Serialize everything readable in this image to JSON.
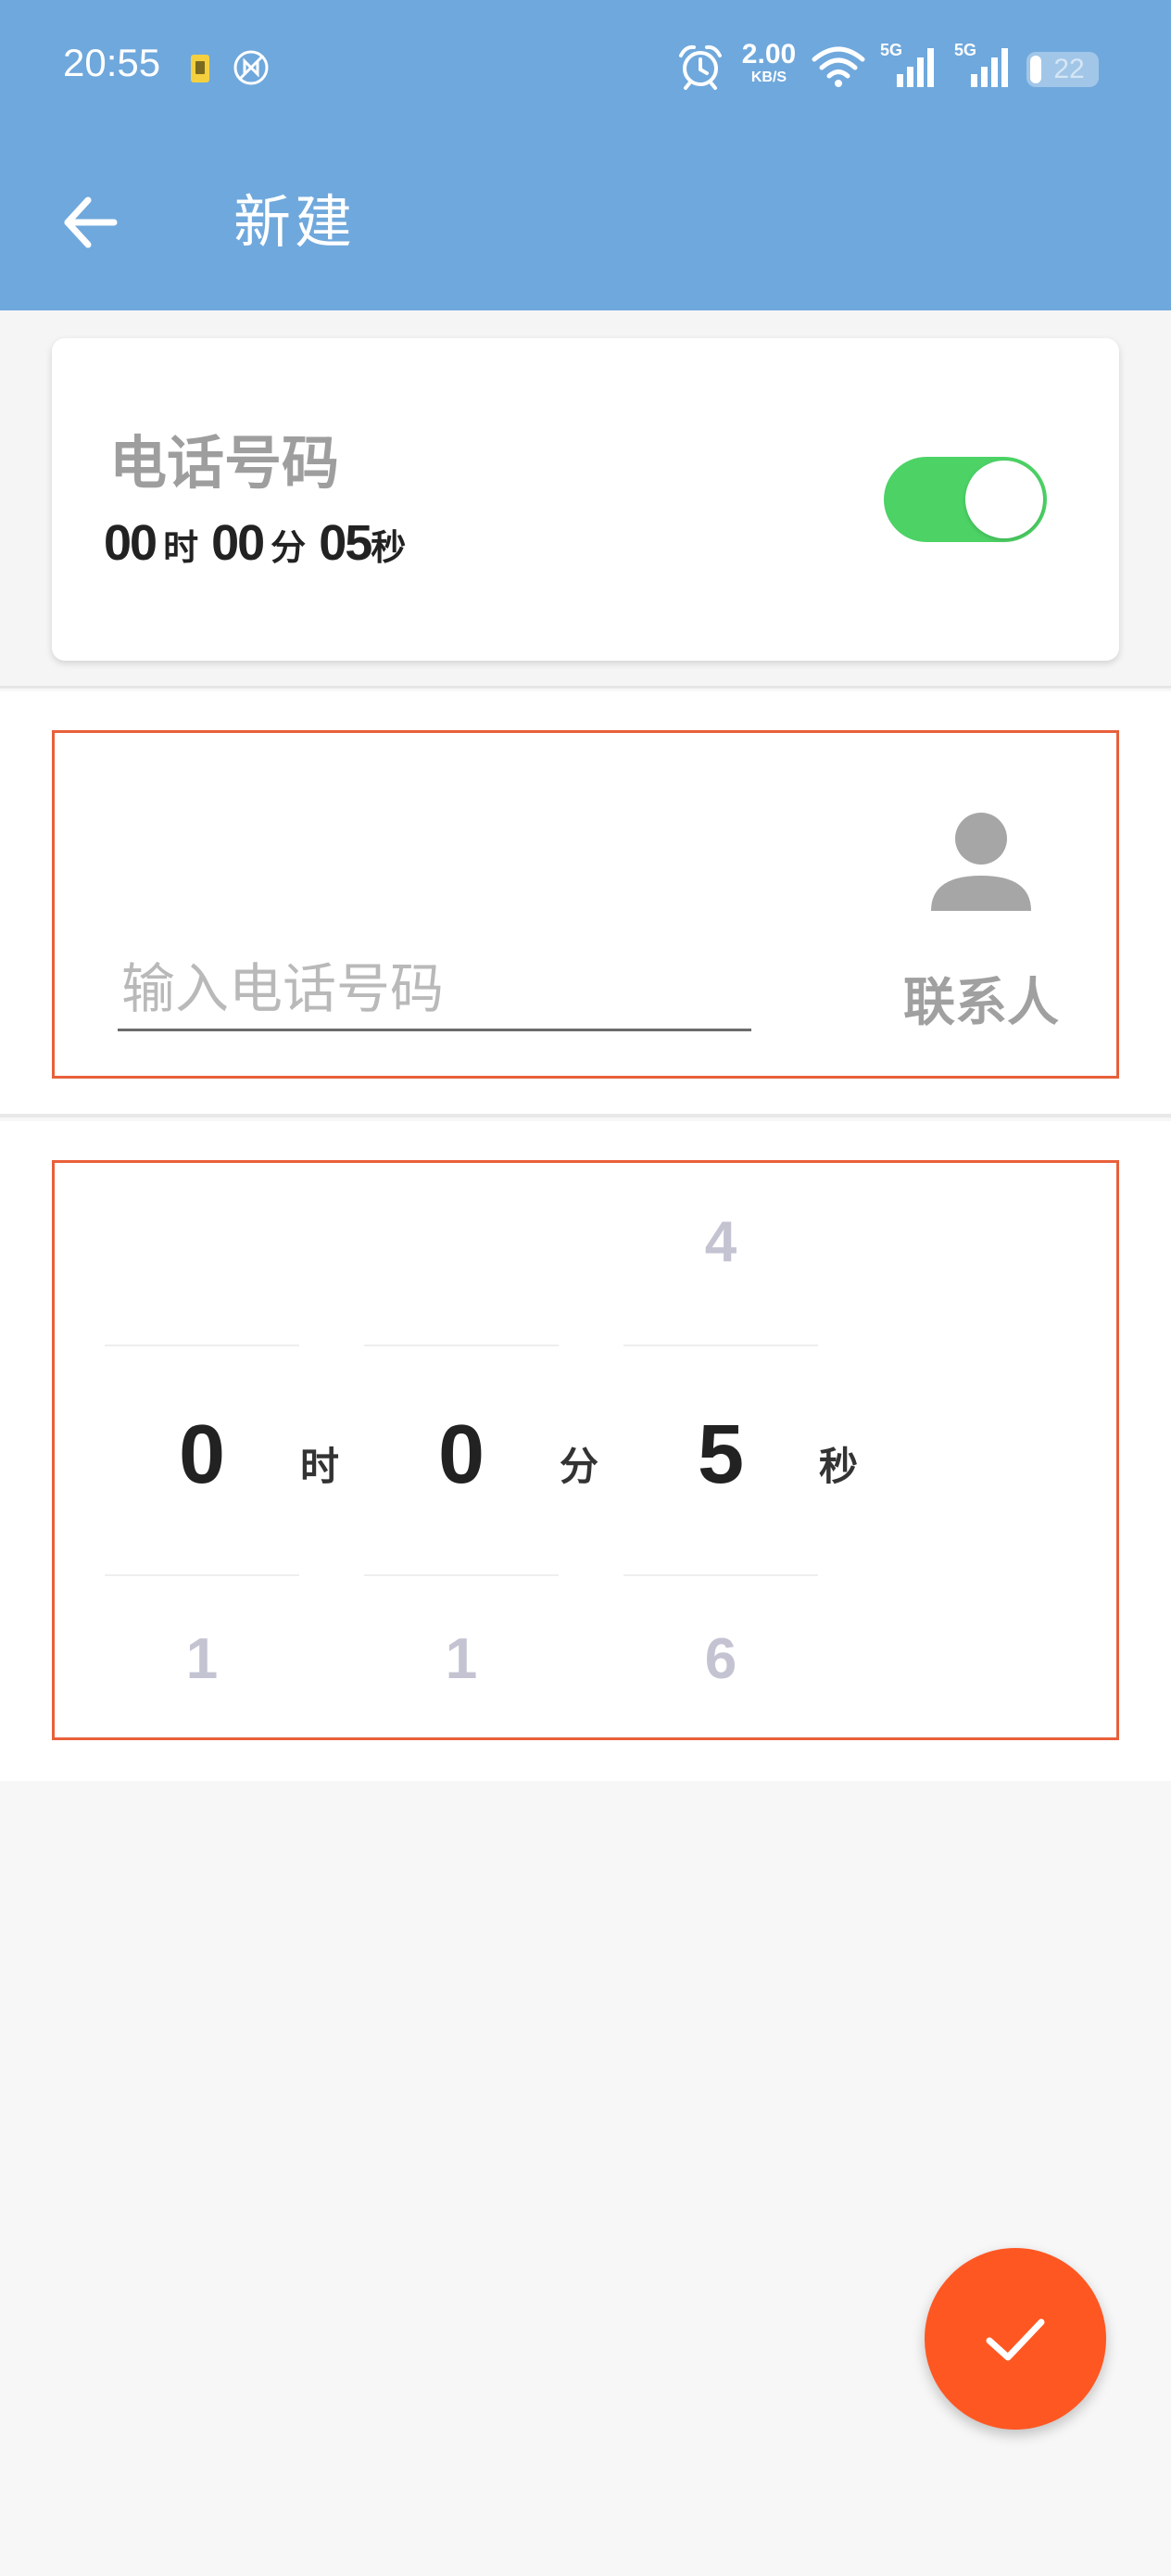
{
  "status_bar": {
    "time": "20:55",
    "net_speed": "2.00",
    "net_speed_unit": "KB/S",
    "signal_1_label": "5G",
    "signal_2_label": "5G",
    "battery_level": "22",
    "icons": [
      "sim-card-icon",
      "nfc-off-icon",
      "alarm-icon",
      "wifi-icon",
      "signal-icon",
      "battery-icon"
    ]
  },
  "app_bar": {
    "title": "新建",
    "back_icon": "arrow-left-icon"
  },
  "summary_card": {
    "title": "电话号码",
    "hours": "00",
    "hours_unit": "时",
    "minutes": "00",
    "minutes_unit": "分",
    "seconds": "05",
    "seconds_unit": "秒",
    "toggle_on": true
  },
  "phone_input": {
    "value": "",
    "placeholder": "输入电话号码",
    "contacts_label": "联系人",
    "contacts_icon": "person-icon"
  },
  "time_picker": {
    "hours": {
      "prev": "",
      "current": "0",
      "next": "1",
      "unit": "时"
    },
    "minutes": {
      "prev": "",
      "current": "0",
      "next": "1",
      "unit": "分"
    },
    "seconds": {
      "prev": "4",
      "current": "5",
      "next": "6",
      "unit": "秒"
    }
  },
  "fab": {
    "icon": "check-icon"
  },
  "colors": {
    "app_bar": "#6fa8dc",
    "toggle_on": "#4cd265",
    "box_border": "#e8603a",
    "fab": "#ff5722",
    "title_gray": "#9e9e9e"
  }
}
